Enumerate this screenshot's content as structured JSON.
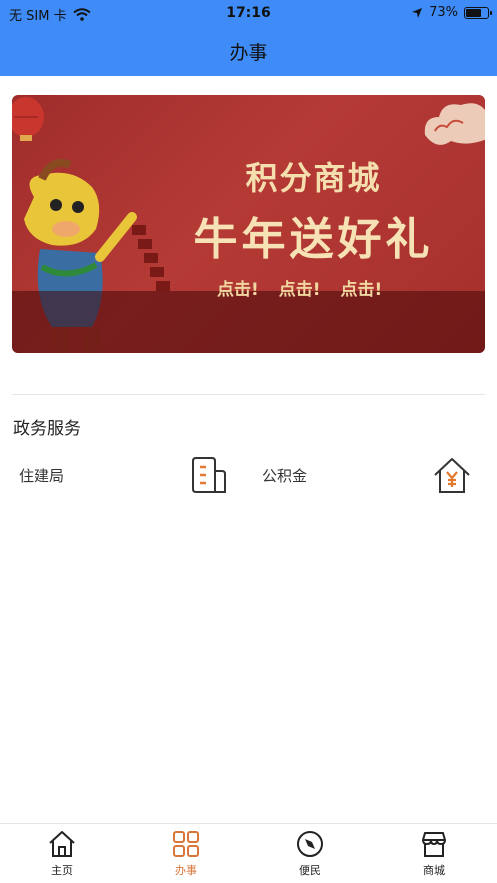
{
  "status_bar": {
    "carrier": "无 SIM 卡",
    "time": "17:16",
    "battery": "73%",
    "battery_level": 0.73
  },
  "header": {
    "title": "办事"
  },
  "banner": {
    "line1": "积分商城",
    "line2": "牛年送好礼",
    "clicks": [
      "点击!",
      "点击!",
      "点击!"
    ]
  },
  "services": {
    "title": "政务服务",
    "items": [
      {
        "label": "住建局",
        "icon": "building-document-icon"
      },
      {
        "label": "公积金",
        "icon": "house-yuan-icon"
      }
    ]
  },
  "tabbar": {
    "items": [
      {
        "label": "主页",
        "icon": "home-icon",
        "active": false
      },
      {
        "label": "办事",
        "icon": "grid-icon",
        "active": true
      },
      {
        "label": "便民",
        "icon": "compass-icon",
        "active": false
      },
      {
        "label": "商城",
        "icon": "store-icon",
        "active": false
      }
    ]
  },
  "colors": {
    "header_bg": "#3f8cf8",
    "active_tab": "#d9773b",
    "banner_red": "#a52f2c",
    "banner_gold": "#f5dfae"
  }
}
